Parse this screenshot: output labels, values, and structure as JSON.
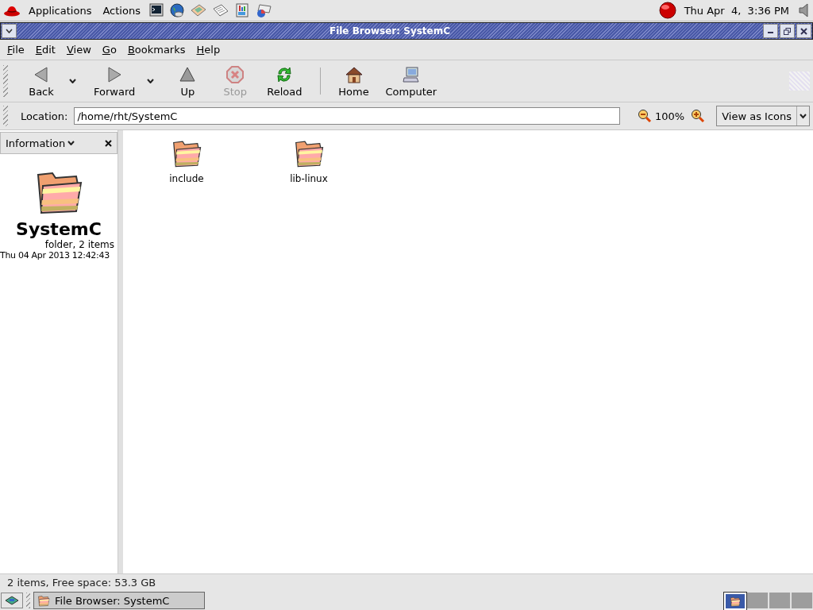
{
  "top_panel": {
    "menus": [
      "Applications",
      "Actions"
    ],
    "clock": "Thu Apr  4,  3:36 PM"
  },
  "window": {
    "title": "File Browser: SystemC"
  },
  "menubar": [
    "File",
    "Edit",
    "View",
    "Go",
    "Bookmarks",
    "Help"
  ],
  "toolbar": [
    {
      "kind": "back",
      "label": "Back",
      "disabled": false,
      "dropdown": true
    },
    {
      "kind": "forward",
      "label": "Forward",
      "disabled": false,
      "dropdown": true
    },
    {
      "kind": "up",
      "label": "Up",
      "disabled": false,
      "dropdown": false
    },
    {
      "kind": "stop",
      "label": "Stop",
      "disabled": true,
      "dropdown": false
    },
    {
      "kind": "reload",
      "label": "Reload",
      "disabled": false,
      "dropdown": false
    },
    {
      "kind": "separator"
    },
    {
      "kind": "home",
      "label": "Home",
      "disabled": false,
      "dropdown": false
    },
    {
      "kind": "computer",
      "label": "Computer",
      "disabled": false,
      "dropdown": false
    }
  ],
  "location": {
    "label": "Location:",
    "value": "/home/rht/SystemC",
    "zoom": "100%",
    "view": "View as Icons"
  },
  "sidebar": {
    "header": "Information",
    "name": "SystemC",
    "info": "folder, 2 items",
    "date": "Thu 04 Apr 2013 12:42:43"
  },
  "files": [
    {
      "name": "include"
    },
    {
      "name": "lib-linux"
    }
  ],
  "status_bar": "2 items, Free space: 53.3 GB",
  "bottom_panel": {
    "tasks": [
      {
        "label": "File Browser: SystemC"
      }
    ],
    "workspaces": [
      {
        "selected": true
      },
      {
        "selected": false
      },
      {
        "selected": false
      },
      {
        "selected": false
      }
    ]
  }
}
